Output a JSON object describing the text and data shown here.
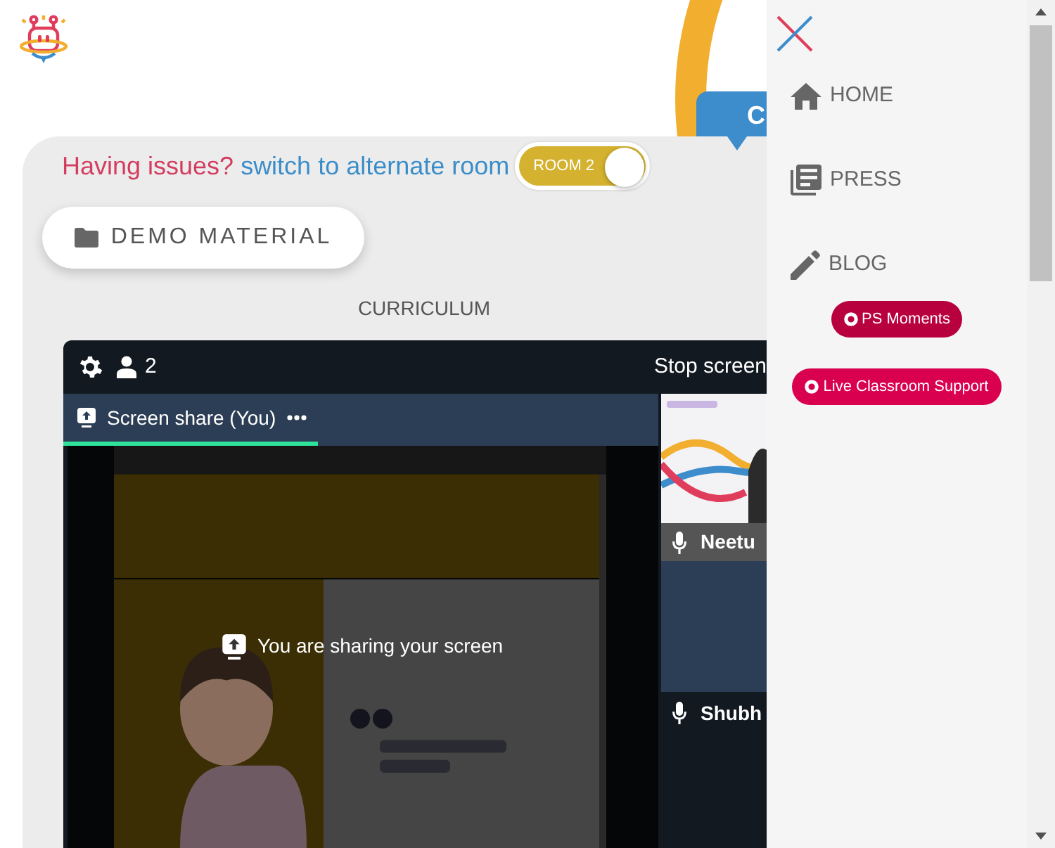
{
  "callout_tab": {
    "label": "C"
  },
  "room_switch": {
    "prompt": "Having issues?",
    "link": "switch to alternate room",
    "toggle": {
      "label": "ROOM 2",
      "on": true
    }
  },
  "demo_material": {
    "label": "DEMO MATERIAL"
  },
  "section_title": "CURRICULUM",
  "call": {
    "participant_count": "2",
    "stop_button": "Stop screen",
    "tab": {
      "label": "Screen share (You)",
      "selected": true
    },
    "sharing_notice": "You are sharing your screen",
    "tiles": [
      {
        "name": "Neetu",
        "kind": "picture"
      },
      {
        "name": "Shubh",
        "kind": "blank"
      }
    ]
  },
  "drawer": {
    "items": [
      {
        "label": "HOME",
        "kind": "home"
      },
      {
        "label": "PRESS",
        "kind": "press"
      },
      {
        "label": "BLOG",
        "kind": "blog"
      }
    ],
    "pills": [
      {
        "label": "PS Moments",
        "color": "#b8003f"
      },
      {
        "label": "Live Classroom Support",
        "color": "#d9004f"
      }
    ]
  }
}
